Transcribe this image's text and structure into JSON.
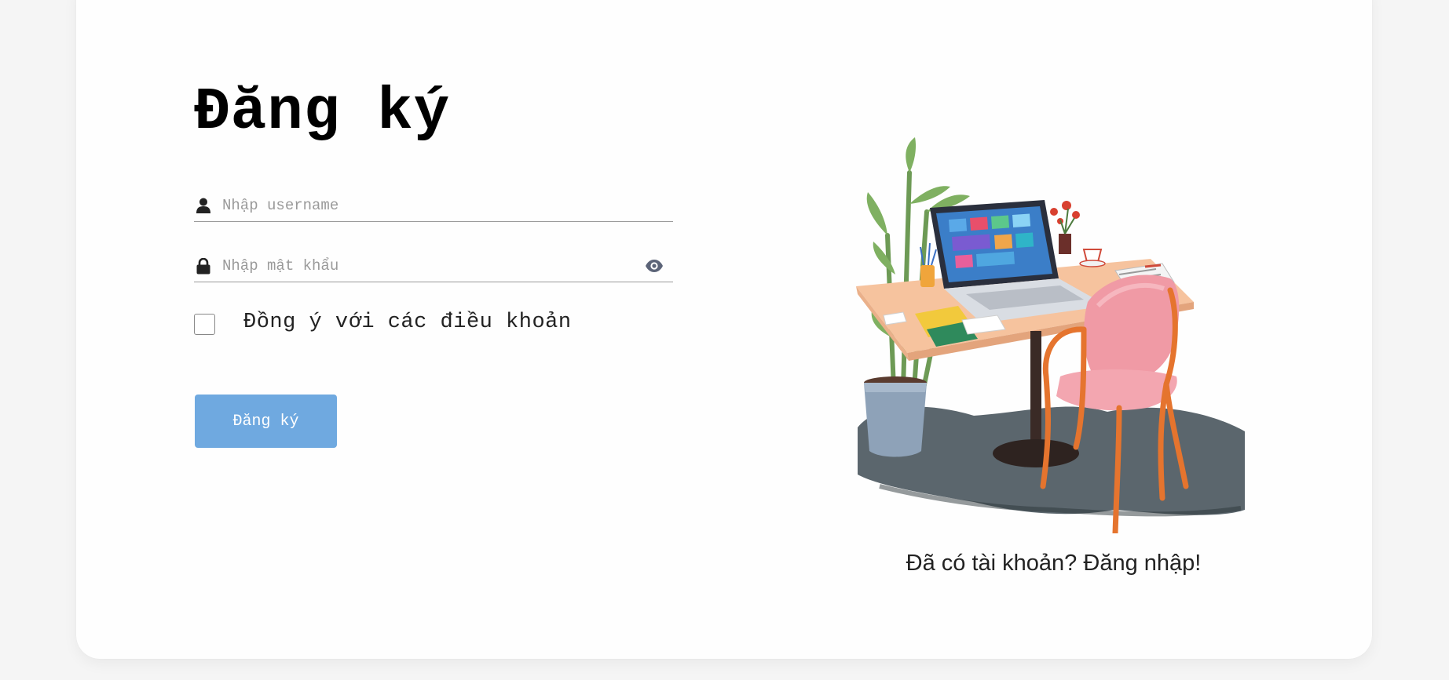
{
  "form": {
    "title": "Đăng ký",
    "username_placeholder": "Nhập username",
    "password_placeholder": "Nhập mật khẩu",
    "agree_label": "Đồng ý với các điều khoản",
    "submit_label": "Đăng ký"
  },
  "side": {
    "login_prompt": "Đã có tài khoản? Đăng nhập!"
  },
  "icons": {
    "username": "user-icon",
    "password": "lock-icon",
    "toggle": "eye-icon"
  },
  "colors": {
    "accent": "#6fa9e0",
    "icon": "#222222",
    "eye": "#5c6478"
  }
}
